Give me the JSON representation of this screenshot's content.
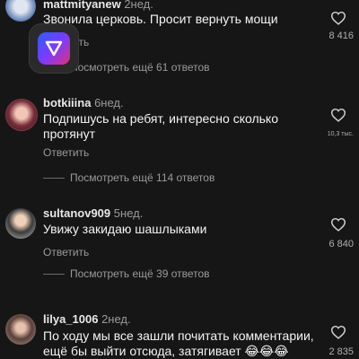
{
  "colors": {
    "background": "#161616",
    "accent_gradient": [
      "#2b5cff",
      "#7a3bff",
      "#e0307a"
    ]
  },
  "comments": [
    {
      "username": "mattmityanew",
      "time": "2нед.",
      "text": "Звонила церковь. Просит вернуть мощи",
      "reply": "Ответить",
      "more": "Посмотреть ещё 61 ответов",
      "likes": "8 416"
    },
    {
      "username": "botkiiina",
      "time": "6нед.",
      "text": "Подпишусь на ребят, интересно сколько протянут",
      "reply": "Ответить",
      "more": "Посмотреть ещё 114 ответов",
      "likes": "10,3 тыс."
    },
    {
      "username": "sultanov909",
      "time": "5нед.",
      "text": "Увижу закидаю шашлыками",
      "reply": "Ответить",
      "more": "Посмотреть ещё 39 ответов",
      "likes": "6 840"
    },
    {
      "username": "lilya_1006",
      "time": "2нед.",
      "text": "По ходу мы все зашли почитать комментарии, ещё бы выйти отсюда,  затягивает 😂😂😂",
      "likes": "2 835"
    }
  ],
  "icons": {
    "like": "heart-outline-icon",
    "app": "play-triangle-icon"
  }
}
